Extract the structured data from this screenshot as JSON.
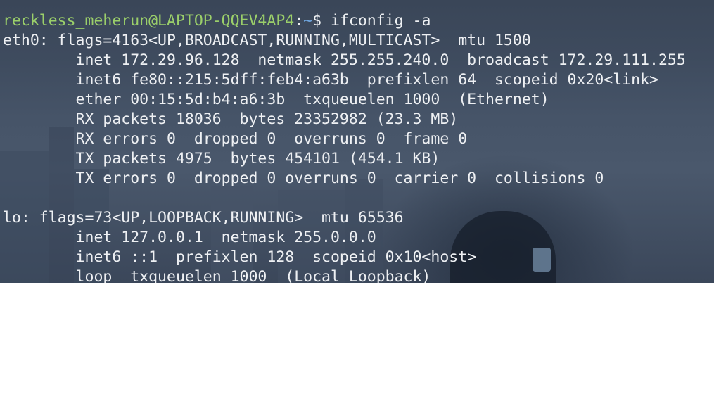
{
  "prompt": {
    "user_host": "reckless_meherun@LAPTOP-QQEV4AP4",
    "separator": ":",
    "path": "~",
    "symbol": "$",
    "command": " ifconfig -a"
  },
  "output_lines": [
    "eth0: flags=4163<UP,BROADCAST,RUNNING,MULTICAST>  mtu 1500",
    "        inet 172.29.96.128  netmask 255.255.240.0  broadcast 172.29.111.255",
    "        inet6 fe80::215:5dff:feb4:a63b  prefixlen 64  scopeid 0x20<link>",
    "        ether 00:15:5d:b4:a6:3b  txqueuelen 1000  (Ethernet)",
    "        RX packets 18036  bytes 23352982 (23.3 MB)",
    "        RX errors 0  dropped 0  overruns 0  frame 0",
    "        TX packets 4975  bytes 454101 (454.1 KB)",
    "        TX errors 0  dropped 0 overruns 0  carrier 0  collisions 0",
    "",
    "lo: flags=73<UP,LOOPBACK,RUNNING>  mtu 65536",
    "        inet 127.0.0.1  netmask 255.0.0.0",
    "        inet6 ::1  prefixlen 128  scopeid 0x10<host>",
    "        loop  txqueuelen 1000  (Local Loopback)"
  ],
  "colors": {
    "user_host": "#9bcf6a",
    "path": "#6fa6e0",
    "text": "#eef0f3"
  }
}
